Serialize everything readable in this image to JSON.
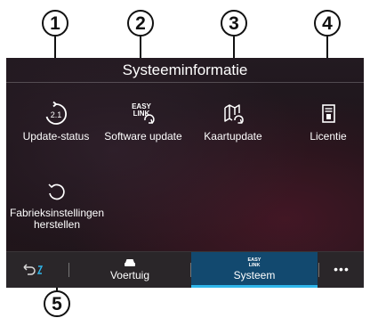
{
  "screen": {
    "title": "Systeeminformatie"
  },
  "callouts": [
    "1",
    "2",
    "3",
    "4",
    "5"
  ],
  "tiles": [
    {
      "label": "Update-status",
      "icon": "update-status-icon",
      "icon_text": "2.1"
    },
    {
      "label": "Software update",
      "icon": "easy-link-update-icon",
      "icon_text_1": "EASY",
      "icon_text_2": "LINK"
    },
    {
      "label": "Kaartupdate",
      "icon": "map-update-icon"
    },
    {
      "label": "Licentie",
      "icon": "license-icon"
    },
    {
      "label_line1": "Fabrieksinstellingen",
      "label_line2": "herstellen",
      "icon": "factory-reset-icon"
    }
  ],
  "bottom_bar": {
    "back_icon": "back-icon",
    "vehicle_label": "Voertuig",
    "vehicle_icon": "car-icon",
    "system_label": "Systeem",
    "system_icon_text_1": "EASY",
    "system_icon_text_2": "LINK",
    "more_label": "•••",
    "accent_color": "#2fb6ea",
    "active_bg": "#12496f"
  }
}
